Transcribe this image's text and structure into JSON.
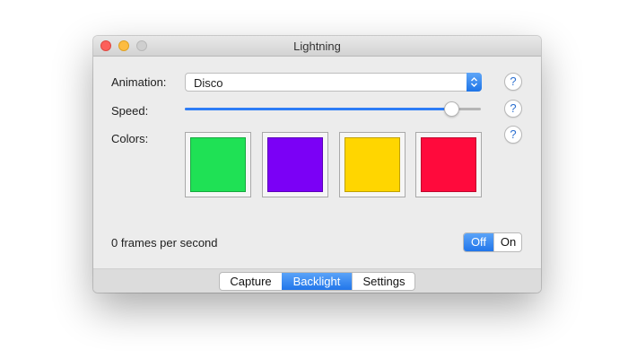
{
  "window": {
    "title": "Lightning"
  },
  "animation": {
    "label": "Animation:",
    "selected": "Disco"
  },
  "speed": {
    "label": "Speed:",
    "value_percent": 90
  },
  "colors": {
    "label": "Colors:",
    "wells": [
      {
        "name": "green",
        "color": "#1fe155"
      },
      {
        "name": "purple",
        "color": "#7b00f6"
      },
      {
        "name": "yellow",
        "color": "#ffd600"
      },
      {
        "name": "red",
        "color": "#ff0a3c"
      }
    ]
  },
  "help": {
    "glyph": "?"
  },
  "status": {
    "text": "0 frames per second"
  },
  "power_toggle": {
    "off_label": "Off",
    "on_label": "On",
    "selected": "Off"
  },
  "tabs": {
    "items": [
      "Capture",
      "Backlight",
      "Settings"
    ],
    "selected": "Backlight"
  },
  "accent": "#2e7df6"
}
